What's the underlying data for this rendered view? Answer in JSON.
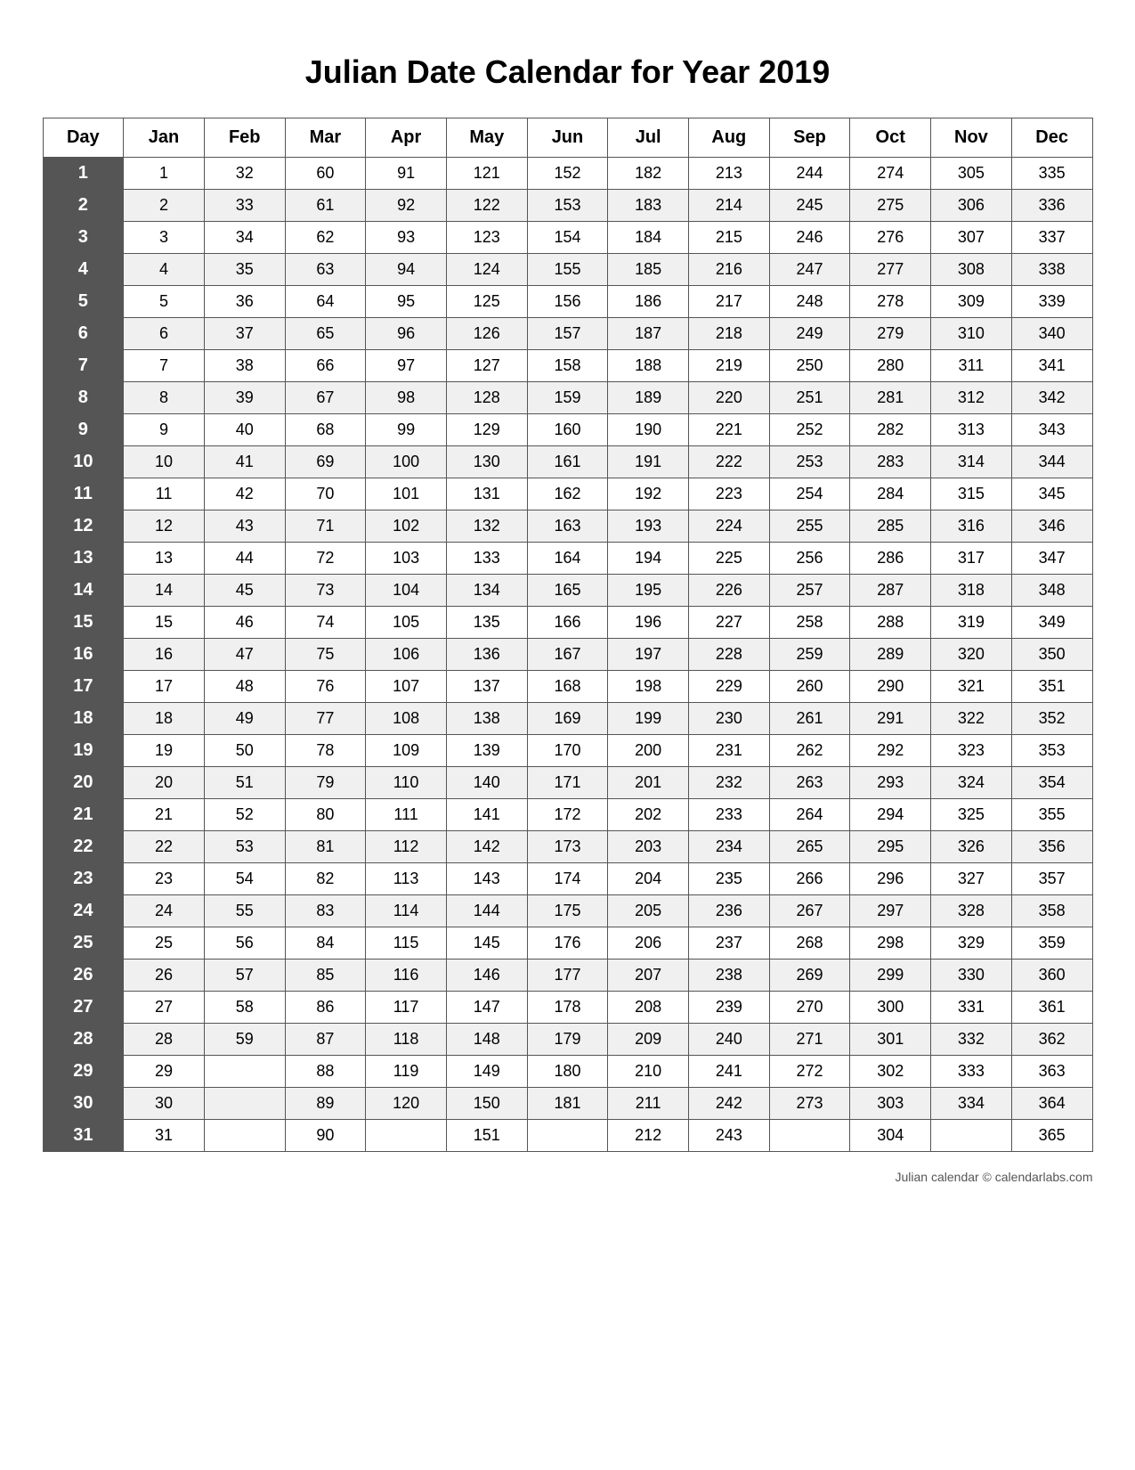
{
  "title": "Julian Date Calendar for Year 2019",
  "headers": [
    "Day",
    "Jan",
    "Feb",
    "Mar",
    "Apr",
    "May",
    "Jun",
    "Jul",
    "Aug",
    "Sep",
    "Oct",
    "Nov",
    "Dec"
  ],
  "rows": [
    {
      "day": 1,
      "jan": 1,
      "feb": 32,
      "mar": 60,
      "apr": 91,
      "may": 121,
      "jun": 152,
      "jul": 182,
      "aug": 213,
      "sep": 244,
      "oct": 274,
      "nov": 305,
      "dec": 335
    },
    {
      "day": 2,
      "jan": 2,
      "feb": 33,
      "mar": 61,
      "apr": 92,
      "may": 122,
      "jun": 153,
      "jul": 183,
      "aug": 214,
      "sep": 245,
      "oct": 275,
      "nov": 306,
      "dec": 336
    },
    {
      "day": 3,
      "jan": 3,
      "feb": 34,
      "mar": 62,
      "apr": 93,
      "may": 123,
      "jun": 154,
      "jul": 184,
      "aug": 215,
      "sep": 246,
      "oct": 276,
      "nov": 307,
      "dec": 337
    },
    {
      "day": 4,
      "jan": 4,
      "feb": 35,
      "mar": 63,
      "apr": 94,
      "may": 124,
      "jun": 155,
      "jul": 185,
      "aug": 216,
      "sep": 247,
      "oct": 277,
      "nov": 308,
      "dec": 338
    },
    {
      "day": 5,
      "jan": 5,
      "feb": 36,
      "mar": 64,
      "apr": 95,
      "may": 125,
      "jun": 156,
      "jul": 186,
      "aug": 217,
      "sep": 248,
      "oct": 278,
      "nov": 309,
      "dec": 339
    },
    {
      "day": 6,
      "jan": 6,
      "feb": 37,
      "mar": 65,
      "apr": 96,
      "may": 126,
      "jun": 157,
      "jul": 187,
      "aug": 218,
      "sep": 249,
      "oct": 279,
      "nov": 310,
      "dec": 340
    },
    {
      "day": 7,
      "jan": 7,
      "feb": 38,
      "mar": 66,
      "apr": 97,
      "may": 127,
      "jun": 158,
      "jul": 188,
      "aug": 219,
      "sep": 250,
      "oct": 280,
      "nov": 311,
      "dec": 341
    },
    {
      "day": 8,
      "jan": 8,
      "feb": 39,
      "mar": 67,
      "apr": 98,
      "may": 128,
      "jun": 159,
      "jul": 189,
      "aug": 220,
      "sep": 251,
      "oct": 281,
      "nov": 312,
      "dec": 342
    },
    {
      "day": 9,
      "jan": 9,
      "feb": 40,
      "mar": 68,
      "apr": 99,
      "may": 129,
      "jun": 160,
      "jul": 190,
      "aug": 221,
      "sep": 252,
      "oct": 282,
      "nov": 313,
      "dec": 343
    },
    {
      "day": 10,
      "jan": 10,
      "feb": 41,
      "mar": 69,
      "apr": 100,
      "may": 130,
      "jun": 161,
      "jul": 191,
      "aug": 222,
      "sep": 253,
      "oct": 283,
      "nov": 314,
      "dec": 344
    },
    {
      "day": 11,
      "jan": 11,
      "feb": 42,
      "mar": 70,
      "apr": 101,
      "may": 131,
      "jun": 162,
      "jul": 192,
      "aug": 223,
      "sep": 254,
      "oct": 284,
      "nov": 315,
      "dec": 345
    },
    {
      "day": 12,
      "jan": 12,
      "feb": 43,
      "mar": 71,
      "apr": 102,
      "may": 132,
      "jun": 163,
      "jul": 193,
      "aug": 224,
      "sep": 255,
      "oct": 285,
      "nov": 316,
      "dec": 346
    },
    {
      "day": 13,
      "jan": 13,
      "feb": 44,
      "mar": 72,
      "apr": 103,
      "may": 133,
      "jun": 164,
      "jul": 194,
      "aug": 225,
      "sep": 256,
      "oct": 286,
      "nov": 317,
      "dec": 347
    },
    {
      "day": 14,
      "jan": 14,
      "feb": 45,
      "mar": 73,
      "apr": 104,
      "may": 134,
      "jun": 165,
      "jul": 195,
      "aug": 226,
      "sep": 257,
      "oct": 287,
      "nov": 318,
      "dec": 348
    },
    {
      "day": 15,
      "jan": 15,
      "feb": 46,
      "mar": 74,
      "apr": 105,
      "may": 135,
      "jun": 166,
      "jul": 196,
      "aug": 227,
      "sep": 258,
      "oct": 288,
      "nov": 319,
      "dec": 349
    },
    {
      "day": 16,
      "jan": 16,
      "feb": 47,
      "mar": 75,
      "apr": 106,
      "may": 136,
      "jun": 167,
      "jul": 197,
      "aug": 228,
      "sep": 259,
      "oct": 289,
      "nov": 320,
      "dec": 350
    },
    {
      "day": 17,
      "jan": 17,
      "feb": 48,
      "mar": 76,
      "apr": 107,
      "may": 137,
      "jun": 168,
      "jul": 198,
      "aug": 229,
      "sep": 260,
      "oct": 290,
      "nov": 321,
      "dec": 351
    },
    {
      "day": 18,
      "jan": 18,
      "feb": 49,
      "mar": 77,
      "apr": 108,
      "may": 138,
      "jun": 169,
      "jul": 199,
      "aug": 230,
      "sep": 261,
      "oct": 291,
      "nov": 322,
      "dec": 352
    },
    {
      "day": 19,
      "jan": 19,
      "feb": 50,
      "mar": 78,
      "apr": 109,
      "may": 139,
      "jun": 170,
      "jul": 200,
      "aug": 231,
      "sep": 262,
      "oct": 292,
      "nov": 323,
      "dec": 353
    },
    {
      "day": 20,
      "jan": 20,
      "feb": 51,
      "mar": 79,
      "apr": 110,
      "may": 140,
      "jun": 171,
      "jul": 201,
      "aug": 232,
      "sep": 263,
      "oct": 293,
      "nov": 324,
      "dec": 354
    },
    {
      "day": 21,
      "jan": 21,
      "feb": 52,
      "mar": 80,
      "apr": 111,
      "may": 141,
      "jun": 172,
      "jul": 202,
      "aug": 233,
      "sep": 264,
      "oct": 294,
      "nov": 325,
      "dec": 355
    },
    {
      "day": 22,
      "jan": 22,
      "feb": 53,
      "mar": 81,
      "apr": 112,
      "may": 142,
      "jun": 173,
      "jul": 203,
      "aug": 234,
      "sep": 265,
      "oct": 295,
      "nov": 326,
      "dec": 356
    },
    {
      "day": 23,
      "jan": 23,
      "feb": 54,
      "mar": 82,
      "apr": 113,
      "may": 143,
      "jun": 174,
      "jul": 204,
      "aug": 235,
      "sep": 266,
      "oct": 296,
      "nov": 327,
      "dec": 357
    },
    {
      "day": 24,
      "jan": 24,
      "feb": 55,
      "mar": 83,
      "apr": 114,
      "may": 144,
      "jun": 175,
      "jul": 205,
      "aug": 236,
      "sep": 267,
      "oct": 297,
      "nov": 328,
      "dec": 358
    },
    {
      "day": 25,
      "jan": 25,
      "feb": 56,
      "mar": 84,
      "apr": 115,
      "may": 145,
      "jun": 176,
      "jul": 206,
      "aug": 237,
      "sep": 268,
      "oct": 298,
      "nov": 329,
      "dec": 359
    },
    {
      "day": 26,
      "jan": 26,
      "feb": 57,
      "mar": 85,
      "apr": 116,
      "may": 146,
      "jun": 177,
      "jul": 207,
      "aug": 238,
      "sep": 269,
      "oct": 299,
      "nov": 330,
      "dec": 360
    },
    {
      "day": 27,
      "jan": 27,
      "feb": 58,
      "mar": 86,
      "apr": 117,
      "may": 147,
      "jun": 178,
      "jul": 208,
      "aug": 239,
      "sep": 270,
      "oct": 300,
      "nov": 331,
      "dec": 361
    },
    {
      "day": 28,
      "jan": 28,
      "feb": 59,
      "mar": 87,
      "apr": 118,
      "may": 148,
      "jun": 179,
      "jul": 209,
      "aug": 240,
      "sep": 271,
      "oct": 301,
      "nov": 332,
      "dec": 362
    },
    {
      "day": 29,
      "jan": 29,
      "feb": null,
      "mar": 88,
      "apr": 119,
      "may": 149,
      "jun": 180,
      "jul": 210,
      "aug": 241,
      "sep": 272,
      "oct": 302,
      "nov": 333,
      "dec": 363
    },
    {
      "day": 30,
      "jan": 30,
      "feb": null,
      "mar": 89,
      "apr": 120,
      "may": 150,
      "jun": 181,
      "jul": 211,
      "aug": 242,
      "sep": 273,
      "oct": 303,
      "nov": 334,
      "dec": 364
    },
    {
      "day": 31,
      "jan": 31,
      "feb": null,
      "mar": 90,
      "apr": null,
      "may": 151,
      "jun": null,
      "jul": 212,
      "aug": 243,
      "sep": null,
      "oct": 304,
      "nov": null,
      "dec": 365
    }
  ],
  "footer": "Julian calendar © calendarlabs.com"
}
